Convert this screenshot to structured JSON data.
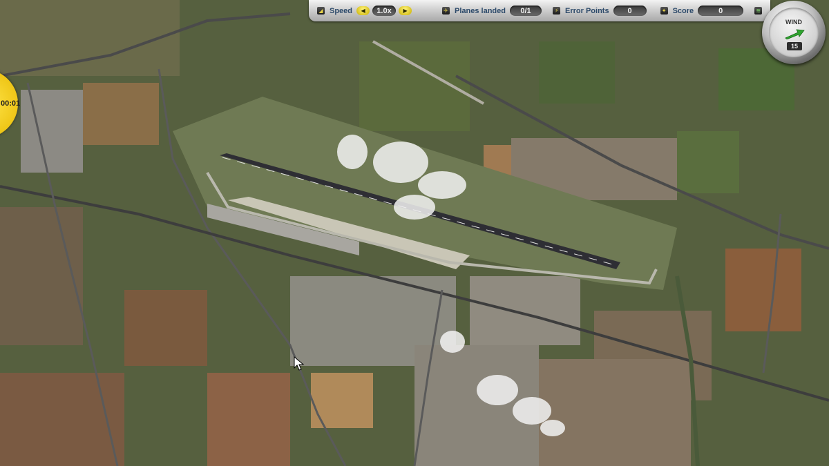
{
  "hud": {
    "speed_label": "Speed",
    "speed_value": "1.0x",
    "planes_landed_label": "Planes landed",
    "planes_landed_value": "0/1",
    "error_points_label": "Error Points",
    "error_points_value": "0",
    "score_label": "Score",
    "score_value": "0"
  },
  "wind": {
    "label": "WIND",
    "value": "15"
  },
  "timer": {
    "value": "00:01"
  },
  "icons": {
    "speed": "speed-icon",
    "planes": "plane-icon",
    "errors": "warning-icon",
    "score": "score-icon",
    "menu": "menu-icon"
  },
  "colors": {
    "hud_text": "#2d4a6a",
    "arrow_buttons": "#f0d800",
    "timer": "#f2c800",
    "wind_arrow": "#2fa52f"
  }
}
